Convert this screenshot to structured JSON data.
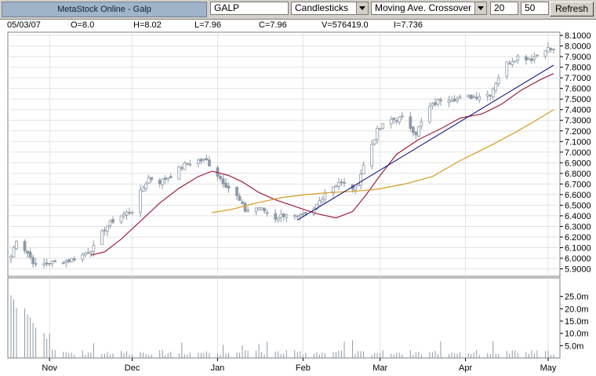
{
  "window": {
    "title": "MetaStock Online - Galp"
  },
  "toolbar": {
    "symbol_value": "GALP",
    "chart_style": "Candlesticks",
    "indicator": "Moving Ave. Crossover",
    "period_short": "20",
    "period_long": "50",
    "refresh_label": "Refresh"
  },
  "info": {
    "date": "05/03/07",
    "open": "O=8.0",
    "high": "H=8.02",
    "low": "L=7.96",
    "close": "C=7.96",
    "volume": "V=576419.0",
    "indicator": "I=7.736"
  },
  "colors": {
    "candle": "#8c9aa8",
    "ma_short": "#a0203c",
    "ma_long": "#d89a20",
    "trendline": "#000080",
    "volume": "#8c9aa8",
    "grid": "#e2e2e2"
  },
  "chart_data": {
    "type": "candlestick",
    "price_axis": {
      "range": [
        5.83,
        8.13
      ],
      "ticks": [
        "5.9000",
        "6.0000",
        "6.1000",
        "6.2000",
        "6.3000",
        "6.4000",
        "6.5000",
        "6.6000",
        "6.7000",
        "6.8000",
        "6.9000",
        "7.0000",
        "7.1000",
        "7.2000",
        "7.3000",
        "7.4000",
        "7.5000",
        "7.6000",
        "7.7000",
        "7.8000",
        "7.9000",
        "8.0000",
        "8.1000"
      ]
    },
    "volume_axis": {
      "range": [
        0,
        30000000
      ],
      "ticks": [
        {
          "v": 5000000,
          "label": "5.0m"
        },
        {
          "v": 10000000,
          "label": "10.0m"
        },
        {
          "v": 15000000,
          "label": "15.0m"
        },
        {
          "v": 20000000,
          "label": "20.0m"
        },
        {
          "v": 25000000,
          "label": "25.0m"
        }
      ]
    },
    "x_axis": {
      "first_date": "2006-10-18",
      "last_date": "2007-05-03",
      "months": [
        "Nov",
        "Dec",
        "Jan",
        "Feb",
        "Mar",
        "Apr",
        "May"
      ],
      "month_starts": [
        "2006-11-01",
        "2006-12-01",
        "2007-01-01",
        "2007-02-01",
        "2007-03-01",
        "2007-04-01",
        "2007-05-01"
      ]
    },
    "close_path": [
      [
        "2006-10-18",
        6.02
      ],
      [
        "2006-10-20",
        6.18
      ],
      [
        "2006-10-24",
        6.05
      ],
      [
        "2006-10-27",
        5.93
      ],
      [
        "2006-11-02",
        5.96
      ],
      [
        "2006-11-08",
        5.98
      ],
      [
        "2006-11-13",
        6.03
      ],
      [
        "2006-11-17",
        6.1
      ],
      [
        "2006-11-21",
        6.28
      ],
      [
        "2006-11-25",
        6.38
      ],
      [
        "2006-12-01",
        6.45
      ],
      [
        "2006-12-04",
        6.62
      ],
      [
        "2006-12-07",
        6.76
      ],
      [
        "2006-12-11",
        6.72
      ],
      [
        "2006-12-15",
        6.78
      ],
      [
        "2006-12-20",
        6.88
      ],
      [
        "2006-12-24",
        6.92
      ],
      [
        "2006-12-28",
        6.92
      ],
      [
        "2007-01-03",
        6.72
      ],
      [
        "2007-01-08",
        6.58
      ],
      [
        "2007-01-11",
        6.45
      ],
      [
        "2007-01-16",
        6.48
      ],
      [
        "2007-01-22",
        6.38
      ],
      [
        "2007-01-26",
        6.42
      ],
      [
        "2007-01-30",
        6.38
      ],
      [
        "2007-02-04",
        6.42
      ],
      [
        "2007-02-09",
        6.62
      ],
      [
        "2007-02-14",
        6.72
      ],
      [
        "2007-02-20",
        6.65
      ],
      [
        "2007-02-24",
        6.95
      ],
      [
        "2007-02-28",
        7.2
      ],
      [
        "2007-03-04",
        7.3
      ],
      [
        "2007-03-09",
        7.32
      ],
      [
        "2007-03-14",
        7.18
      ],
      [
        "2007-03-19",
        7.42
      ],
      [
        "2007-03-24",
        7.52
      ],
      [
        "2007-03-29",
        7.5
      ],
      [
        "2007-04-03",
        7.52
      ],
      [
        "2007-04-10",
        7.55
      ],
      [
        "2007-04-15",
        7.82
      ],
      [
        "2007-04-20",
        7.9
      ],
      [
        "2007-04-25",
        7.88
      ],
      [
        "2007-04-30",
        7.98
      ],
      [
        "2007-05-03",
        7.96
      ]
    ],
    "series": [
      {
        "name": "20",
        "color": "#a0203c",
        "points": [
          [
            "2006-11-16",
            6.03
          ],
          [
            "2006-11-21",
            6.06
          ],
          [
            "2006-11-27",
            6.18
          ],
          [
            "2006-12-04",
            6.35
          ],
          [
            "2006-12-11",
            6.52
          ],
          [
            "2006-12-18",
            6.66
          ],
          [
            "2006-12-25",
            6.77
          ],
          [
            "2006-12-30",
            6.82
          ],
          [
            "2007-01-05",
            6.78
          ],
          [
            "2007-01-10",
            6.72
          ],
          [
            "2007-01-16",
            6.62
          ],
          [
            "2007-01-22",
            6.55
          ],
          [
            "2007-01-30",
            6.48
          ],
          [
            "2007-02-06",
            6.42
          ],
          [
            "2007-02-13",
            6.38
          ],
          [
            "2007-02-19",
            6.44
          ],
          [
            "2007-02-24",
            6.6
          ],
          [
            "2007-03-01",
            6.78
          ],
          [
            "2007-03-07",
            6.98
          ],
          [
            "2007-03-15",
            7.12
          ],
          [
            "2007-03-23",
            7.22
          ],
          [
            "2007-03-30",
            7.32
          ],
          [
            "2007-04-07",
            7.36
          ],
          [
            "2007-04-14",
            7.45
          ],
          [
            "2007-04-21",
            7.58
          ],
          [
            "2007-04-28",
            7.68
          ],
          [
            "2007-05-03",
            7.74
          ]
        ]
      },
      {
        "name": "50",
        "color": "#d89a20",
        "points": [
          [
            "2006-12-30",
            6.43
          ],
          [
            "2007-01-06",
            6.46
          ],
          [
            "2007-01-15",
            6.52
          ],
          [
            "2007-01-24",
            6.57
          ],
          [
            "2007-02-02",
            6.6
          ],
          [
            "2007-02-11",
            6.62
          ],
          [
            "2007-02-19",
            6.63
          ],
          [
            "2007-02-28",
            6.65
          ],
          [
            "2007-03-10",
            6.7
          ],
          [
            "2007-03-20",
            6.77
          ],
          [
            "2007-03-30",
            6.92
          ],
          [
            "2007-04-10",
            7.06
          ],
          [
            "2007-04-20",
            7.2
          ],
          [
            "2007-04-28",
            7.32
          ],
          [
            "2007-05-03",
            7.4
          ]
        ]
      }
    ],
    "trendline": [
      [
        "2007-01-30",
        6.36
      ],
      [
        "2007-05-03",
        7.82
      ]
    ]
  }
}
